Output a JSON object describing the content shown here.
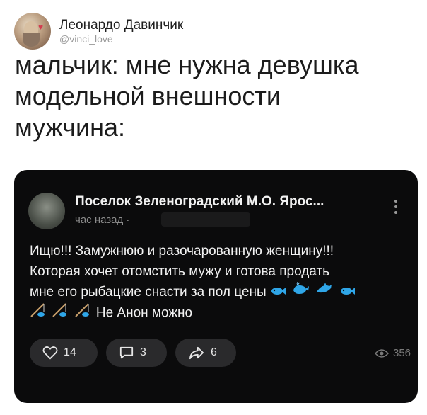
{
  "tweet": {
    "author": {
      "display_name": "Леонардо Давинчик",
      "handle": "@vinci_love",
      "avatar_icon": "leonardo-portrait-avatar"
    },
    "text": "мальчик: мне нужна девушка\nмодельной внешности\nмужчина:"
  },
  "post": {
    "group_name": "Поселок Зеленоградский М.О. Ярос...",
    "time": "час назад ·",
    "body_line1": "Ищю!!! Замужнюю и разочарованную женщину!!!",
    "body_line2": "Которая хочет отомстить мужу и готова продать",
    "body_line3": "мне его рыбацкие снасти за пол цены",
    "body_line4": "Не Анон можно",
    "likes": "14",
    "comments": "3",
    "shares": "6",
    "views": "356",
    "icons": {
      "fish": "fish-emoji",
      "whale": "whale-emoji",
      "dolphin": "dolphin-emoji",
      "fishing": "fishing-pole-emoji",
      "like": "heart-icon",
      "comment": "comment-icon",
      "share": "share-icon",
      "view": "eye-icon",
      "more": "more-icon"
    },
    "colors": {
      "card_bg": "#0b0b0c",
      "pill_bg": "#2a2a2c",
      "emoji_blue": "#2fa6e8"
    }
  }
}
